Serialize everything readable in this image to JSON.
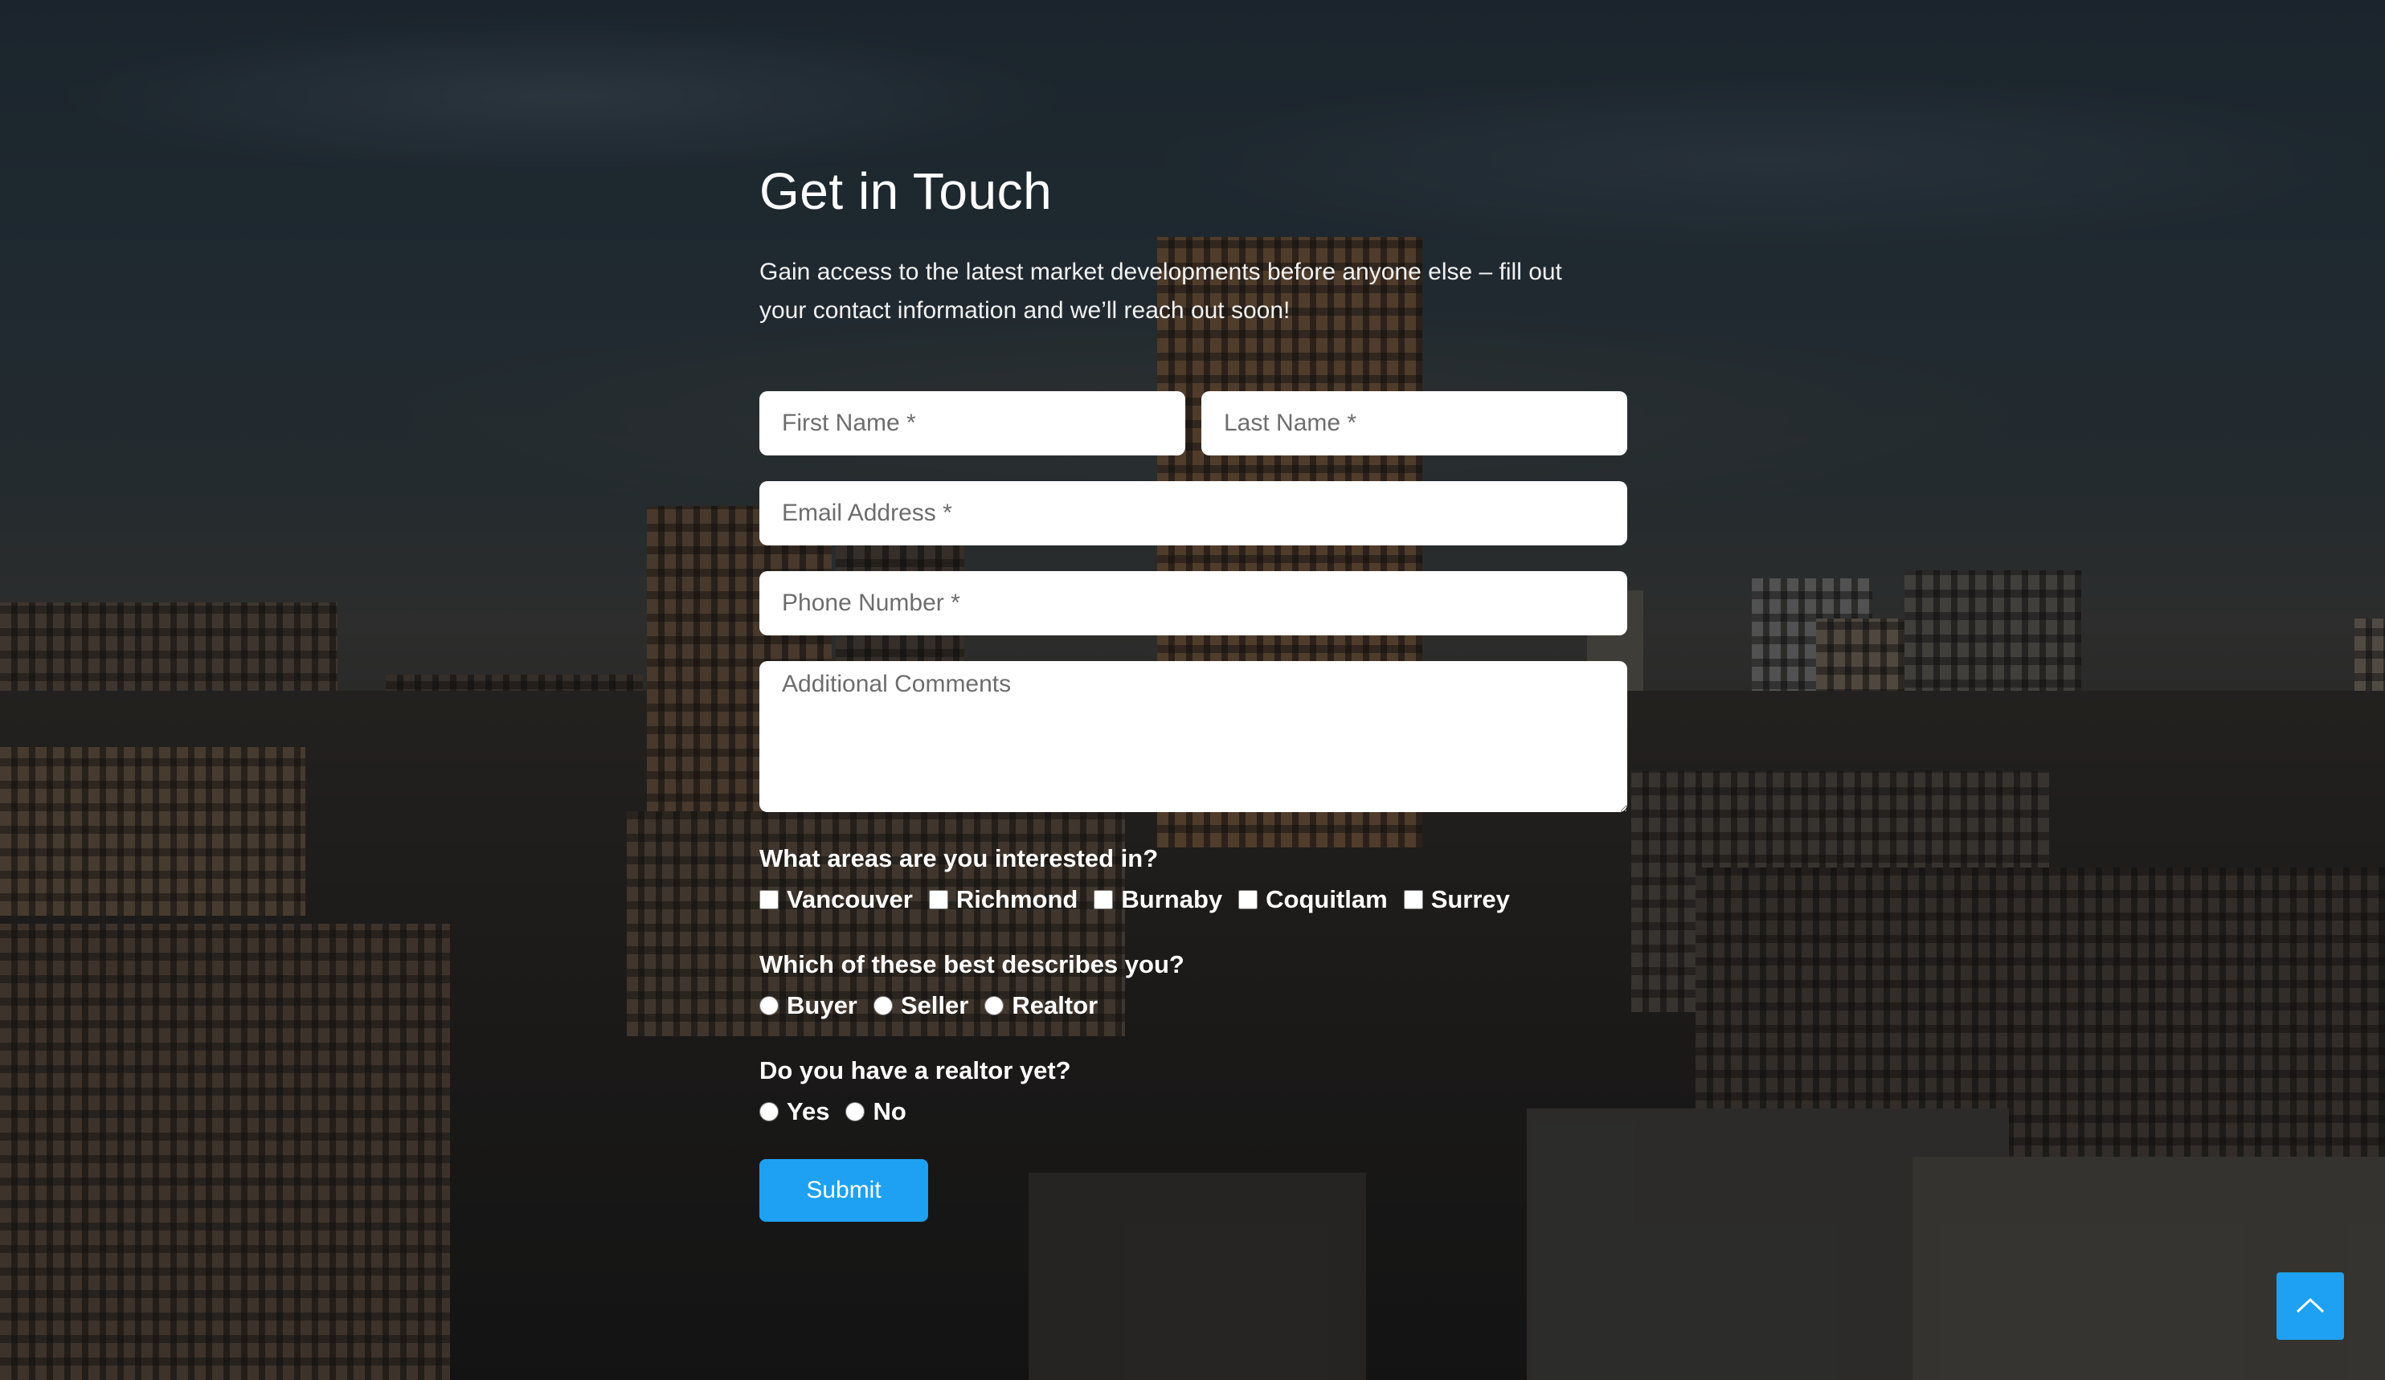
{
  "form": {
    "title": "Get in Touch",
    "intro": "Gain access to the latest market developments before anyone else – fill out your contact information and we’ll reach out soon!",
    "first_name_placeholder": "First Name *",
    "last_name_placeholder": "Last Name *",
    "email_placeholder": "Email Address *",
    "phone_placeholder": "Phone Number *",
    "comments_placeholder": "Additional Comments",
    "areas": {
      "question": "What areas are you interested in?",
      "options": [
        "Vancouver",
        "Richmond",
        "Burnaby",
        "Coquitlam",
        "Surrey"
      ]
    },
    "role": {
      "question": "Which of these best describes you?",
      "options": [
        "Buyer",
        "Seller",
        "Realtor"
      ]
    },
    "realtor": {
      "question": "Do you have a realtor yet?",
      "options": [
        "Yes",
        "No"
      ]
    },
    "submit_label": "Submit"
  },
  "scroll_top": {
    "icon": "chevron-up-icon"
  },
  "colors": {
    "accent": "#1ea1f2",
    "text": "#ffffff",
    "field_bg": "#ffffff"
  }
}
